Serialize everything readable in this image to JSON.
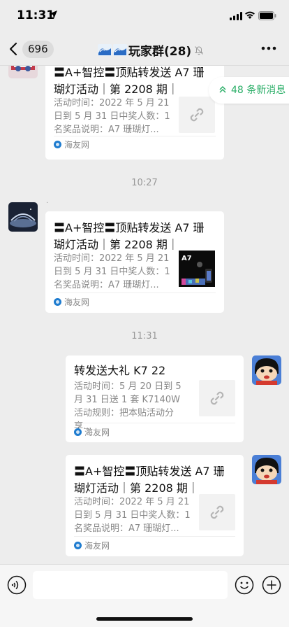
{
  "status_bar": {
    "time": "11:31"
  },
  "nav": {
    "unread_count": "696",
    "group_name": "玩家群(28)"
  },
  "new_messages": {
    "label": "48 条新消息"
  },
  "messages": [
    {
      "title": "〓A+智控〓顶贴转发送 A7 珊瑚灯活动｜第 2208 期｜",
      "desc": "活动时间：2022 年 5 月 21 日到 5 月 31 日中奖人数：1 名奖品说明：A7 珊瑚灯...",
      "source": "海友网"
    },
    {
      "timestamp": "10:27",
      "sender": "·",
      "title": "〓A+智控〓顶贴转发送 A7 珊瑚灯活动｜第 2208 期｜",
      "desc": "活动时间：2022 年 5 月 21 日到 5 月 31 日中奖人数：1 名奖品说明：A7 珊瑚灯...",
      "thumb_text": "A7",
      "source": "海友网"
    },
    {
      "timestamp": "11:31",
      "title": "转发送大礼 K7 22",
      "desc": "活动时间：5 月 20 日到 5 月 31 日送 1 套 K7140W 活动规则：把本贴活动分享...",
      "source": "海友网"
    },
    {
      "title": "〓A+智控〓顶贴转发送 A7 珊瑚灯活动｜第 2208 期｜",
      "desc": "活动时间：2022 年 5 月 21 日到 5 月 31 日中奖人数：1 名奖品说明：A7 珊瑚灯...",
      "source": "海友网"
    }
  ],
  "colors": {
    "accent": "#2aae67",
    "background": "#ededed",
    "card": "#ffffff"
  },
  "icons": [
    "location-arrow-icon",
    "signal-icon",
    "wifi-icon",
    "battery-icon",
    "back-icon",
    "wave-icon",
    "mute-bell-icon",
    "more-icon",
    "double-chevron-up-icon",
    "link-icon",
    "voice-icon",
    "emoji-icon",
    "plus-icon"
  ]
}
